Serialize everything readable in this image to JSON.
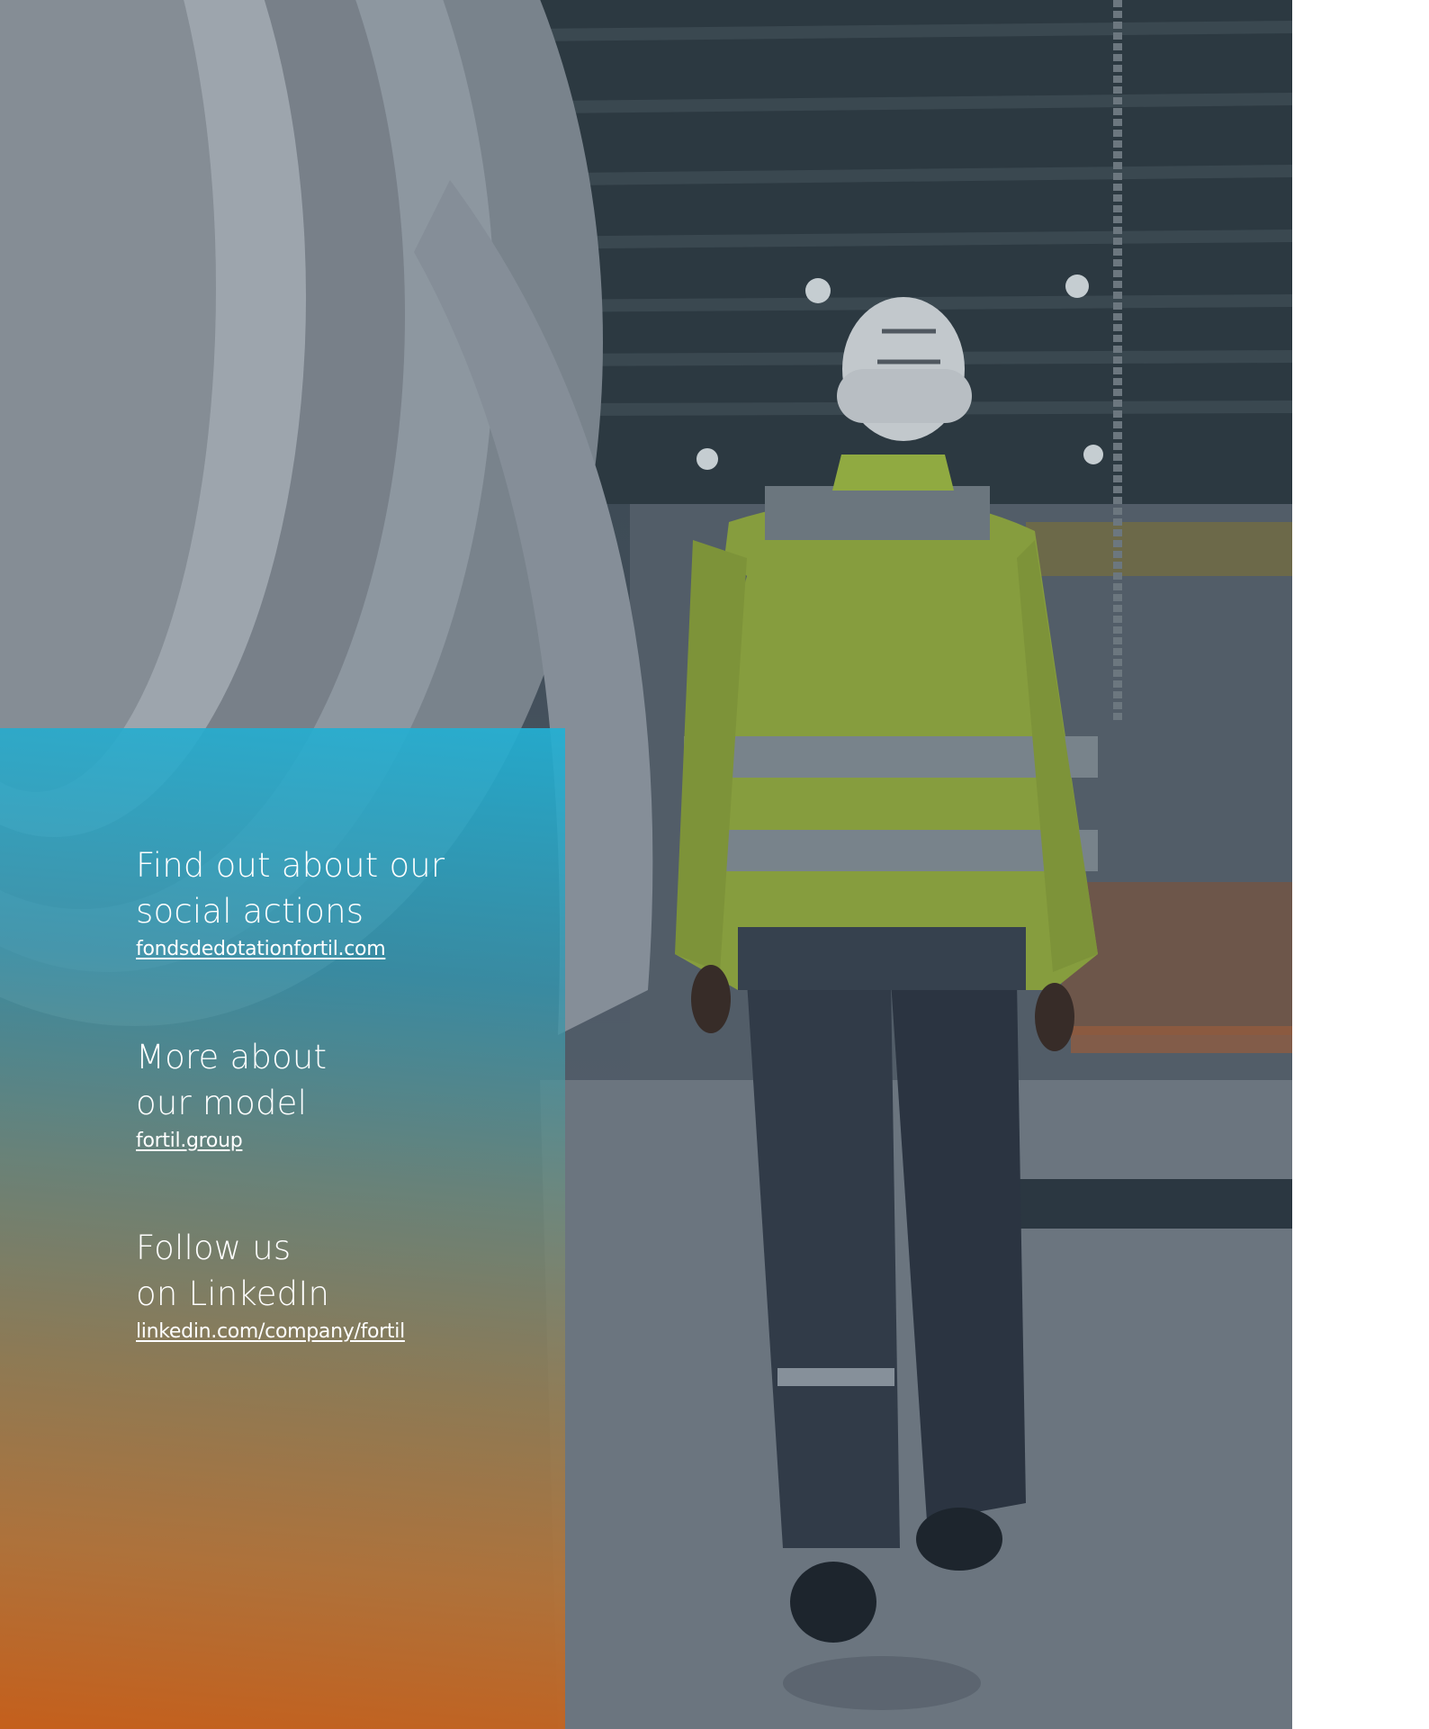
{
  "colors": {
    "panel_top": "#22b0d4",
    "panel_bottom": "#c85f19",
    "text": "#ffffff",
    "vest": "#a8c43a"
  },
  "photo": {
    "subject": "worker-in-hi-vis-jacket-and-helmet"
  },
  "links": [
    {
      "title_line1": "Find out about our",
      "title_line2": "social actions",
      "url_text": "fondsdedotationfortil.com"
    },
    {
      "title_line1": "More about",
      "title_line2": "our model",
      "url_text": "fortil.group"
    },
    {
      "title_line1": "Follow us",
      "title_line2": "on LinkedIn",
      "url_text": "linkedin.com/company/fortil"
    }
  ]
}
